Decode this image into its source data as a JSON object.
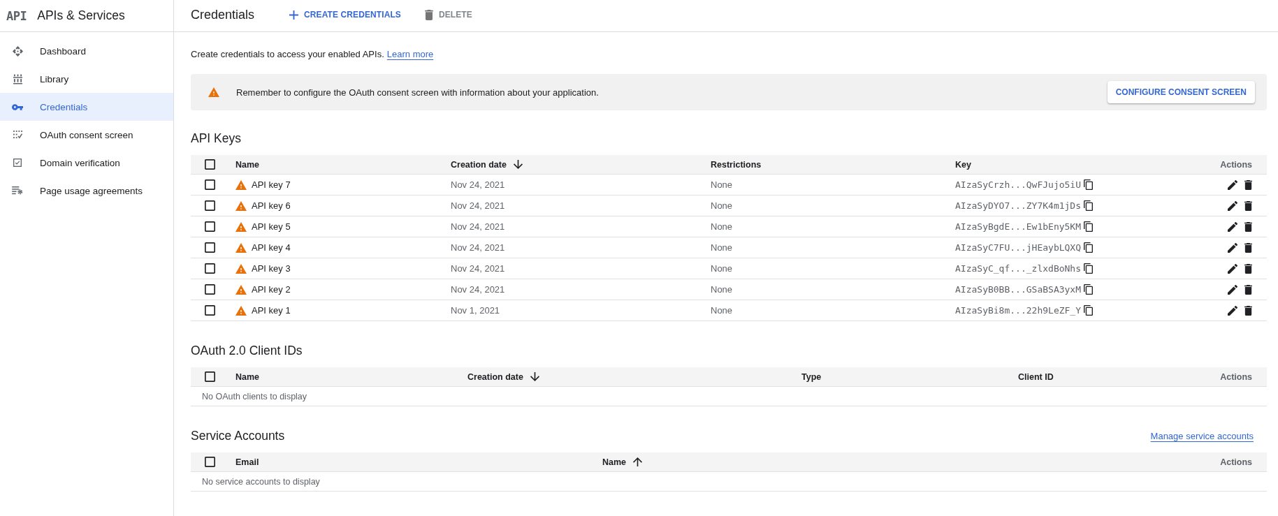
{
  "sidebar": {
    "logo": "API",
    "title": "APIs & Services",
    "items": [
      {
        "label": "Dashboard",
        "selected": false
      },
      {
        "label": "Library",
        "selected": false
      },
      {
        "label": "Credentials",
        "selected": true
      },
      {
        "label": "OAuth consent screen",
        "selected": false
      },
      {
        "label": "Domain verification",
        "selected": false
      },
      {
        "label": "Page usage agreements",
        "selected": false
      }
    ]
  },
  "header": {
    "title": "Credentials",
    "actions": [
      {
        "label": "CREATE CREDENTIALS",
        "disabled": false
      },
      {
        "label": "DELETE",
        "disabled": true
      }
    ]
  },
  "intro": {
    "text": "Create credentials to access your enabled APIs.",
    "link": "Learn more"
  },
  "notice": {
    "message": "Remember to configure the OAuth consent screen with information about your application.",
    "button": "CONFIGURE CONSENT SCREEN"
  },
  "api_keys": {
    "title": "API Keys",
    "select_all": {
      "checked": false
    },
    "columns": [
      {
        "label": "Name",
        "sorted": false
      },
      {
        "label": "Creation date",
        "sorted": true,
        "ascending": false
      },
      {
        "label": "Restrictions",
        "sorted": false
      },
      {
        "label": "Key",
        "sorted": false
      },
      {
        "label": "Actions",
        "sorted": false
      }
    ],
    "rows": [
      {
        "name": "API key 7",
        "warning": true,
        "created": "Nov 24, 2021",
        "restrictions": "None",
        "key": "AIzaSyCrzh...QwFJujo5iU",
        "checked": false
      },
      {
        "name": "API key 6",
        "warning": true,
        "created": "Nov 24, 2021",
        "restrictions": "None",
        "key": "AIzaSyDYO7...ZY7K4m1jDs",
        "checked": false
      },
      {
        "name": "API key 5",
        "warning": true,
        "created": "Nov 24, 2021",
        "restrictions": "None",
        "key": "AIzaSyBgdE...Ew1bEny5KM",
        "checked": false
      },
      {
        "name": "API key 4",
        "warning": true,
        "created": "Nov 24, 2021",
        "restrictions": "None",
        "key": "AIzaSyC7FU...jHEaybLQXQ",
        "checked": false
      },
      {
        "name": "API key 3",
        "warning": true,
        "created": "Nov 24, 2021",
        "restrictions": "None",
        "key": "AIzaSyC_qf..._zlxdBoNhs",
        "checked": false
      },
      {
        "name": "API key 2",
        "warning": true,
        "created": "Nov 24, 2021",
        "restrictions": "None",
        "key": "AIzaSyB0BB...GSaBSA3yxM",
        "checked": false
      },
      {
        "name": "API key 1",
        "warning": true,
        "created": "Nov 1, 2021",
        "restrictions": "None",
        "key": "AIzaSyBi8m...22h9LeZF_Y",
        "checked": false
      }
    ]
  },
  "oauth_clients": {
    "title": "OAuth 2.0 Client IDs",
    "select_all": {
      "checked": false
    },
    "columns": [
      {
        "label": "Name",
        "sorted": false
      },
      {
        "label": "Creation date",
        "sorted": true,
        "ascending": false
      },
      {
        "label": "Type",
        "sorted": false
      },
      {
        "label": "Client ID",
        "sorted": false
      },
      {
        "label": "Actions",
        "sorted": false
      }
    ],
    "empty_message": "No OAuth clients to display"
  },
  "service_accounts": {
    "title": "Service Accounts",
    "link": "Manage service accounts",
    "select_all": {
      "checked": false
    },
    "columns": [
      {
        "label": "Email",
        "sorted": false
      },
      {
        "label": "Name",
        "sorted": true,
        "ascending": true
      },
      {
        "label": "Actions",
        "sorted": false
      }
    ],
    "empty_message": "No service accounts to display"
  }
}
